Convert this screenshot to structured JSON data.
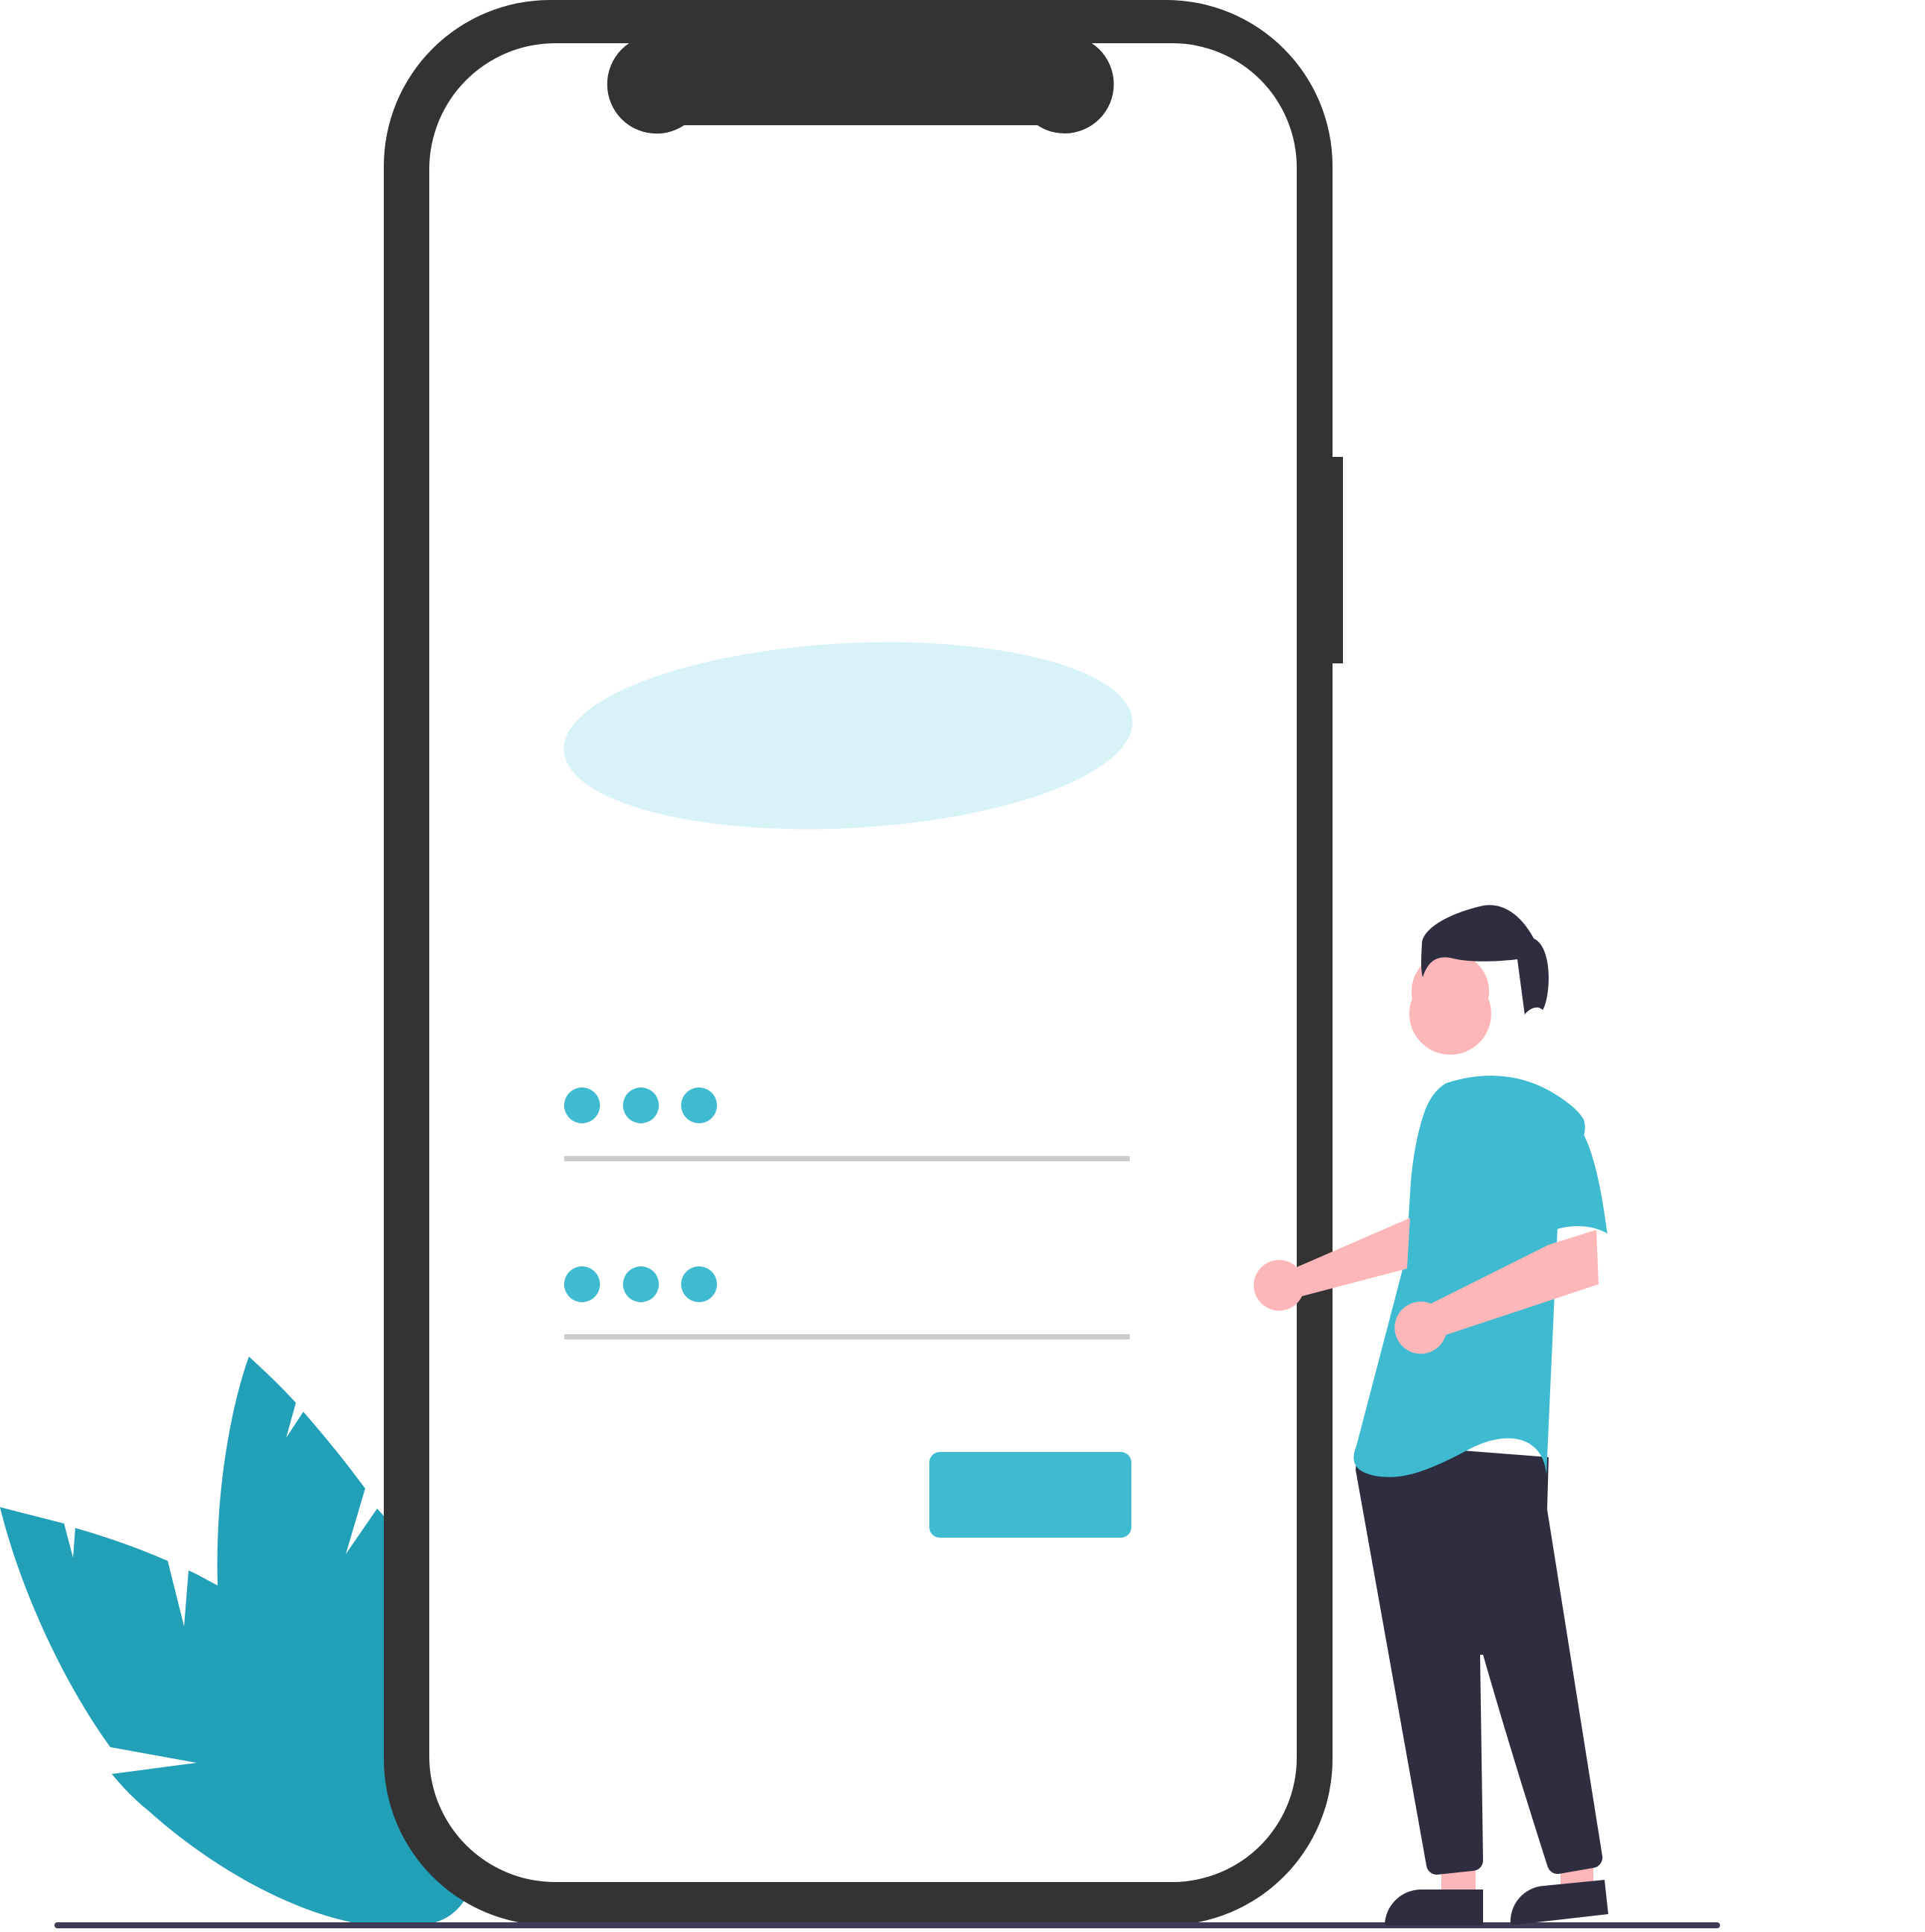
{
  "illustration": {
    "kind": "login-screen-illustration",
    "elements": {
      "plant": "plant-icon",
      "phone": "phone-icon",
      "notch": "phone-notch",
      "side_button": "phone-side-button",
      "placeholder_banner": "banner-placeholder",
      "person": "person-icon"
    }
  },
  "form": {
    "fields": [
      {
        "name": "username-field",
        "masked_char_count": 3
      },
      {
        "name": "password-field",
        "masked_char_count": 3
      }
    ],
    "submit_button": {
      "name": "submit-button"
    }
  },
  "colors": {
    "phone_frame": "#333333",
    "screen": "#ffffff",
    "accent": "#3fbbd1",
    "accent_light": "#d7f3f7",
    "plant": "#22a0b8",
    "field_line": "#cccccc",
    "skin": "#fdb7b8",
    "dark": "#2f2e41",
    "ground": "#3f3d56"
  }
}
